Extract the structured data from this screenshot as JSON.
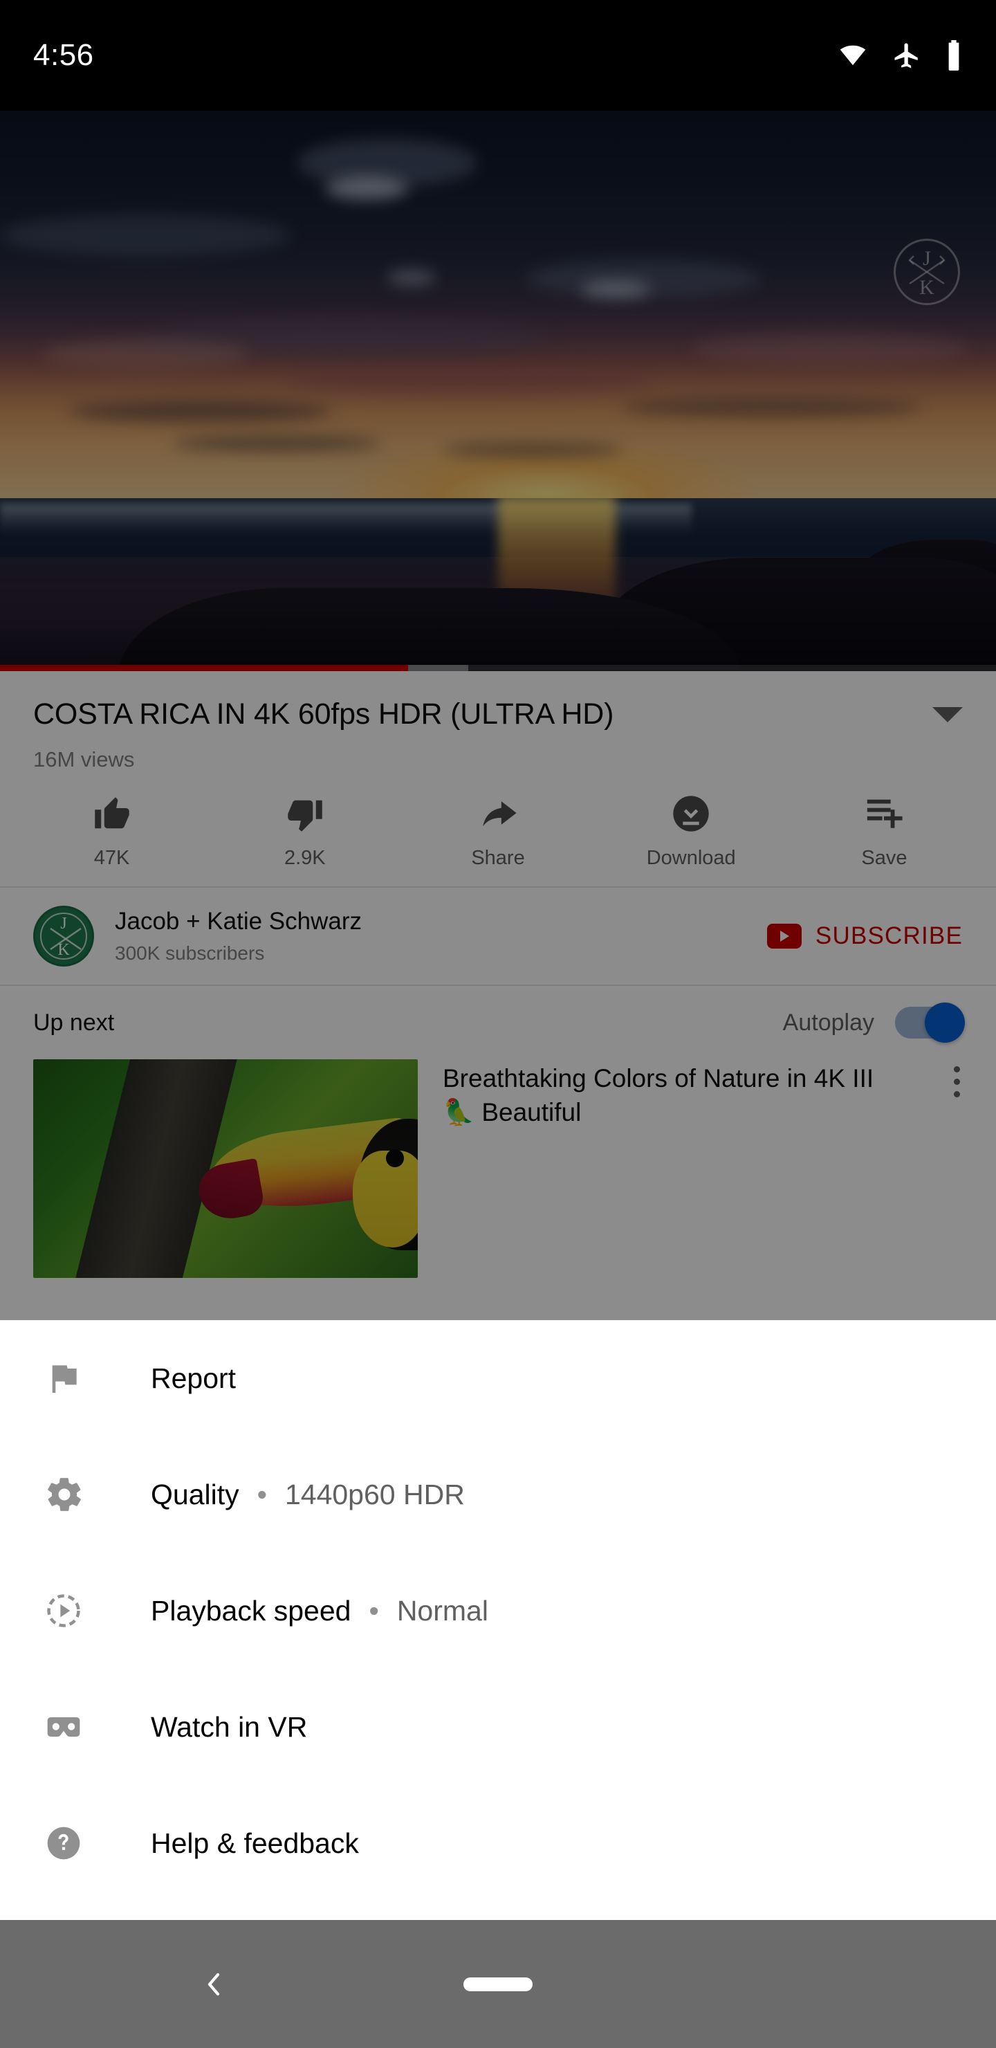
{
  "status_bar": {
    "time": "4:56",
    "icons": [
      "wifi-icon",
      "airplane-mode-icon",
      "battery-icon"
    ]
  },
  "player": {
    "scene_description": "Sunset over ocean beach with dark rocks in foreground",
    "watermark": {
      "top_letter": "J",
      "bottom_letter": "K"
    },
    "progress_played_percent": 41,
    "progress_buffered_percent": 47,
    "progress_color": "#cc0000"
  },
  "video": {
    "title": "COSTA RICA IN 4K 60fps HDR (ULTRA HD)",
    "views": "16M views",
    "expand_icon": "chevron-down-icon"
  },
  "actions": [
    {
      "icon": "thumbs-up-icon",
      "label": "47K"
    },
    {
      "icon": "thumbs-down-icon",
      "label": "2.9K"
    },
    {
      "icon": "share-icon",
      "label": "Share"
    },
    {
      "icon": "download-icon",
      "label": "Download"
    },
    {
      "icon": "save-to-playlist-icon",
      "label": "Save"
    }
  ],
  "channel": {
    "avatar_top_letter": "J",
    "avatar_bottom_letter": "K",
    "avatar_color": "#1f7a4d",
    "name": "Jacob + Katie Schwarz",
    "subscribers": "300K subscribers",
    "subscribe_label": "SUBSCRIBE",
    "subscribe_color": "#cc0000"
  },
  "up_next": {
    "label": "Up next",
    "autoplay_label": "Autoplay",
    "autoplay_on": true,
    "autoplay_accent": "#065fd4",
    "item": {
      "title": "Breathtaking Colors of Nature in 4K III 🦜 Beautiful",
      "thumbnail_description": "Keel-billed toucan on a branch",
      "more_icon": "overflow-menu-icon"
    }
  },
  "sheet": {
    "items": [
      {
        "icon": "flag-icon",
        "title": "Report",
        "separator": "",
        "value": ""
      },
      {
        "icon": "gear-icon",
        "title": "Quality",
        "separator": "•",
        "value": "1440p60 HDR"
      },
      {
        "icon": "playback-speed-icon",
        "title": "Playback speed",
        "separator": "•",
        "value": "Normal"
      },
      {
        "icon": "vr-cardboard-icon",
        "title": "Watch in VR",
        "separator": "",
        "value": ""
      },
      {
        "icon": "help-circle-icon",
        "title": "Help & feedback",
        "separator": "",
        "value": ""
      }
    ]
  },
  "nav_bar": {
    "back_icon": "chevron-left-icon",
    "home_pill": "home-gesture-pill"
  }
}
